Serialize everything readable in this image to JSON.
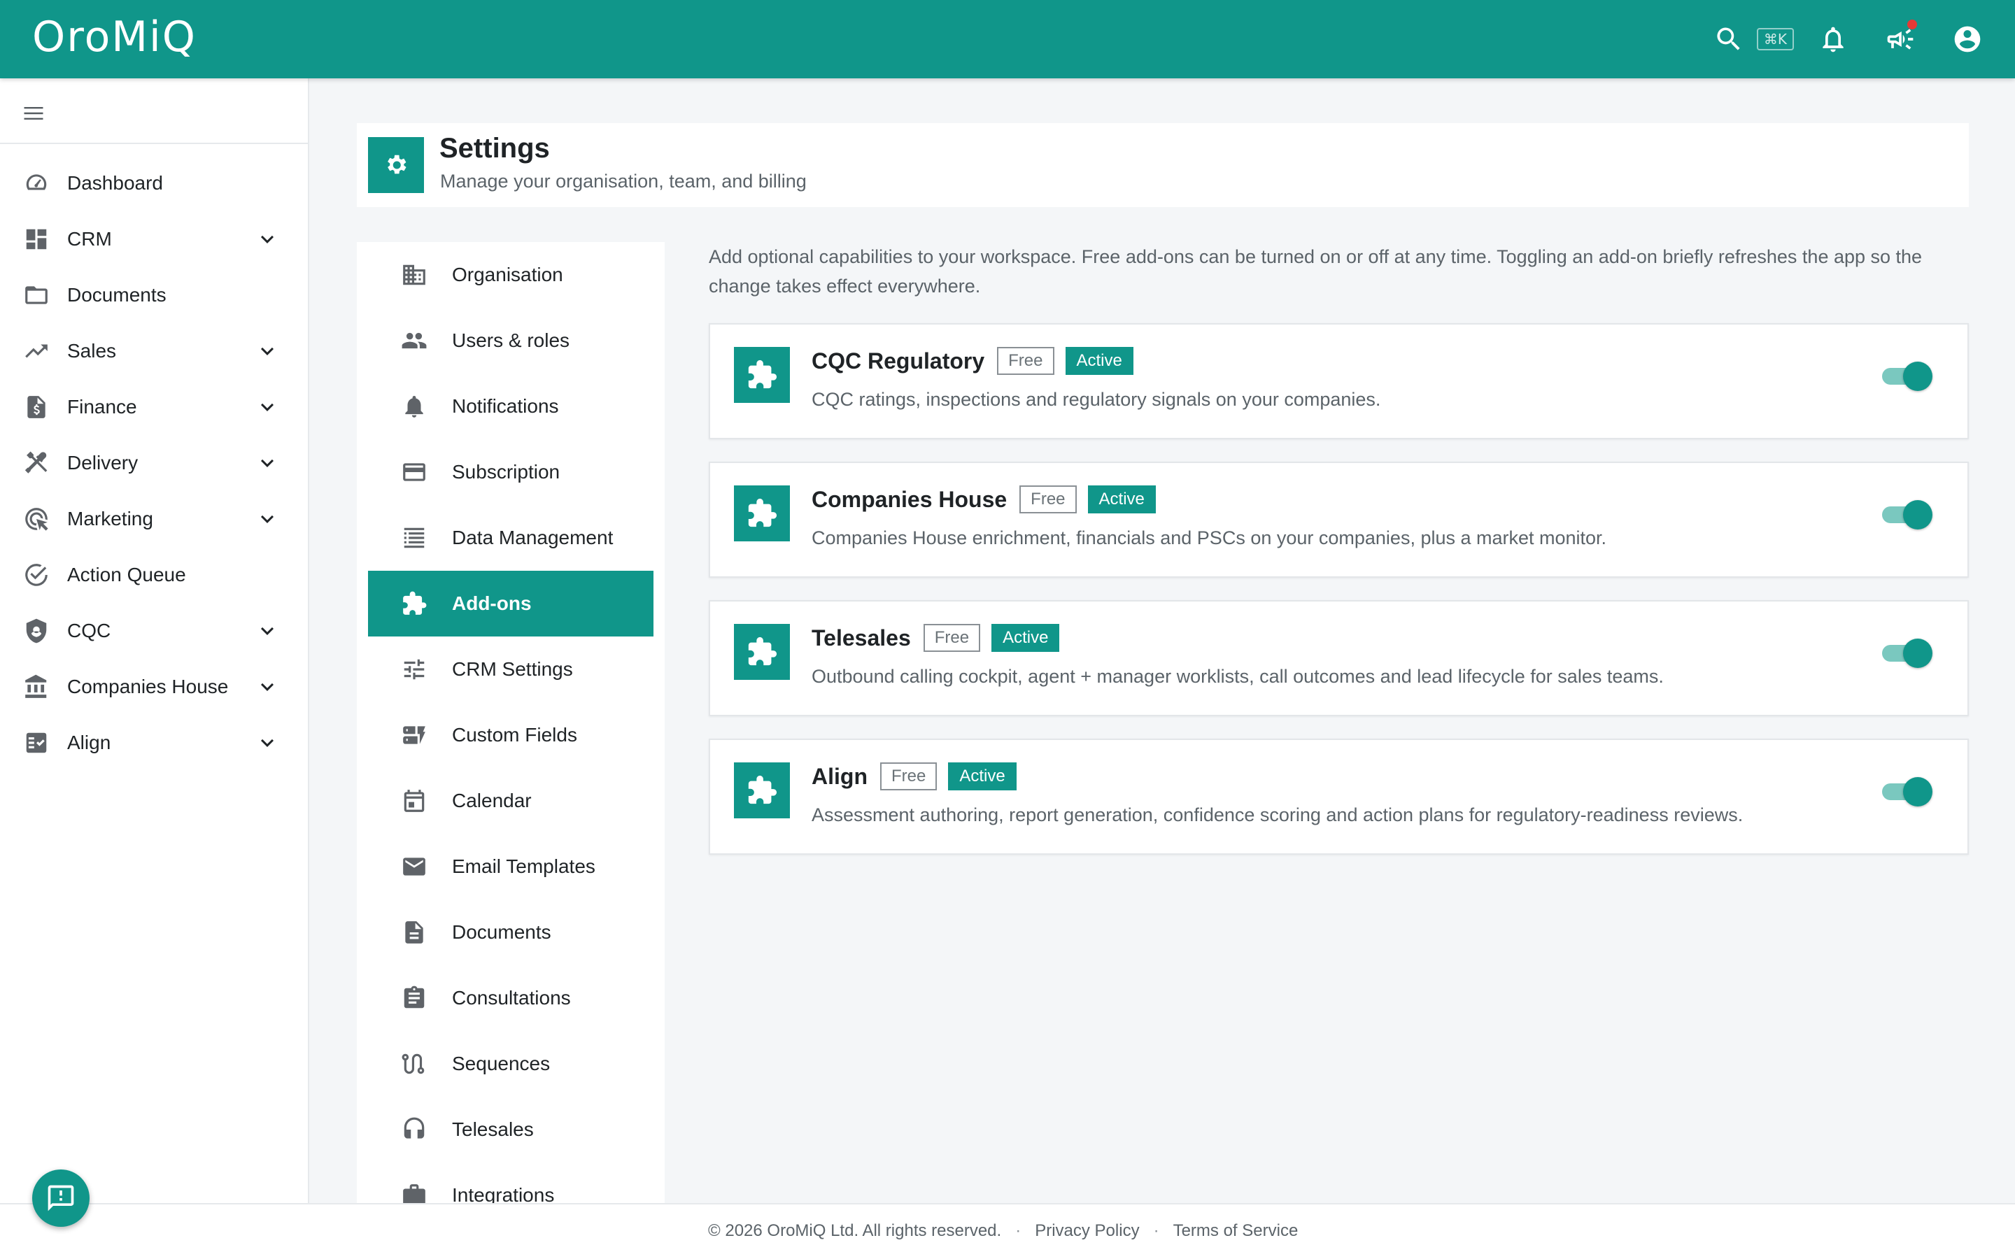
{
  "app": {
    "logo": "OroMiQ",
    "shortcut": "⌘K"
  },
  "colors": {
    "brand": "#10968a",
    "active_tag": "#10968a",
    "notification_dot": "#e53935"
  },
  "sidebar": {
    "items": [
      {
        "label": "Dashboard",
        "icon": "speedometer-icon",
        "expandable": false
      },
      {
        "label": "CRM",
        "icon": "dashboard-grid-icon",
        "expandable": true
      },
      {
        "label": "Documents",
        "icon": "folder-icon",
        "expandable": false
      },
      {
        "label": "Sales",
        "icon": "trending-up-icon",
        "expandable": true
      },
      {
        "label": "Finance",
        "icon": "invoice-icon",
        "expandable": true
      },
      {
        "label": "Delivery",
        "icon": "tools-icon",
        "expandable": true
      },
      {
        "label": "Marketing",
        "icon": "target-cursor-icon",
        "expandable": true
      },
      {
        "label": "Action Queue",
        "icon": "check-circle-icon",
        "expandable": false
      },
      {
        "label": "CQC",
        "icon": "shield-icon",
        "expandable": true
      },
      {
        "label": "Companies House",
        "icon": "bank-icon",
        "expandable": true
      },
      {
        "label": "Align",
        "icon": "checklist-icon",
        "expandable": true
      }
    ]
  },
  "header": {
    "title": "Settings",
    "subtitle": "Manage your organisation, team, and billing"
  },
  "settings_nav": {
    "items": [
      {
        "label": "Organisation",
        "icon": "building-icon"
      },
      {
        "label": "Users & roles",
        "icon": "users-icon"
      },
      {
        "label": "Notifications",
        "icon": "bell-icon"
      },
      {
        "label": "Subscription",
        "icon": "credit-card-icon"
      },
      {
        "label": "Data Management",
        "icon": "list-icon"
      },
      {
        "label": "Add-ons",
        "icon": "puzzle-icon",
        "active": true
      },
      {
        "label": "CRM Settings",
        "icon": "sliders-icon"
      },
      {
        "label": "Custom Fields",
        "icon": "dynamic-form-icon"
      },
      {
        "label": "Calendar",
        "icon": "calendar-icon"
      },
      {
        "label": "Email Templates",
        "icon": "mail-icon"
      },
      {
        "label": "Documents",
        "icon": "file-icon"
      },
      {
        "label": "Consultations",
        "icon": "clipboard-icon"
      },
      {
        "label": "Sequences",
        "icon": "route-icon"
      },
      {
        "label": "Telesales",
        "icon": "headset-icon"
      },
      {
        "label": "Integrations",
        "icon": "briefcase-icon"
      }
    ]
  },
  "addons": {
    "intro": "Add optional capabilities to your workspace. Free add-ons can be turned on or off at any time. Toggling an add-on briefly refreshes the app so the change takes effect everywhere.",
    "items": [
      {
        "name": "CQC Regulatory",
        "free_label": "Free",
        "status": "Active",
        "description": "CQC ratings, inspections and regulatory signals on your companies.",
        "enabled": true
      },
      {
        "name": "Companies House",
        "free_label": "Free",
        "status": "Active",
        "description": "Companies House enrichment, financials and PSCs on your companies, plus a market monitor.",
        "enabled": true
      },
      {
        "name": "Telesales",
        "free_label": "Free",
        "status": "Active",
        "description": "Outbound calling cockpit, agent + manager worklists, call outcomes and lead lifecycle for sales teams.",
        "enabled": true
      },
      {
        "name": "Align",
        "free_label": "Free",
        "status": "Active",
        "description": "Assessment authoring, report generation, confidence scoring and action plans for regulatory-readiness reviews.",
        "enabled": true
      }
    ]
  },
  "footer": {
    "copyright": "© 2026 OroMiQ Ltd. All rights reserved.",
    "separator": "·",
    "privacy": "Privacy Policy",
    "terms": "Terms of Service"
  }
}
